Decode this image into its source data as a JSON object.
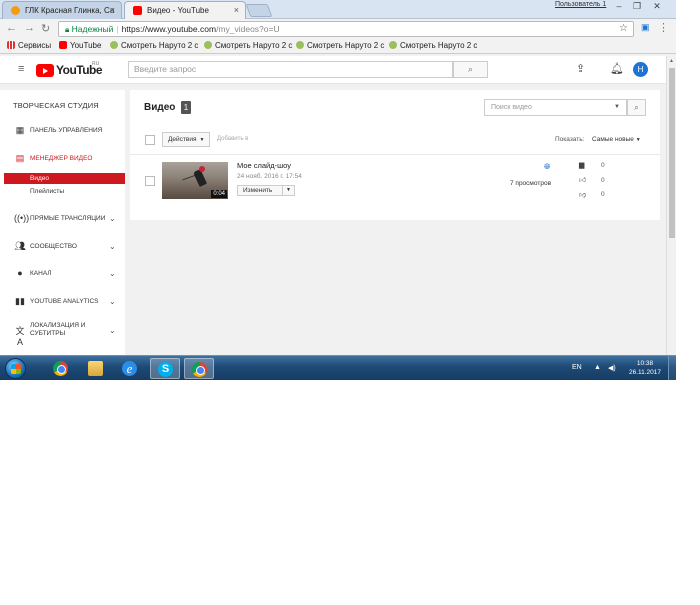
{
  "browser": {
    "tabs": [
      {
        "title": "ГЛК Красная Глинка, Са",
        "icon_color": "#f39c12"
      },
      {
        "title": "Видео - YouTube",
        "icon_color": "#ff0000"
      }
    ],
    "user_label": "Пользователь 1",
    "secure_label": "Надежный",
    "url_main": "https://www.youtube.com",
    "url_path": "/my_videos?o=U",
    "bookmarks": [
      {
        "label": "Сервисы",
        "icon": "apps-icon"
      },
      {
        "label": "YouTube",
        "icon": "youtube-icon"
      },
      {
        "label": "Смотреть Наруто 2 с",
        "icon": "naruto-icon"
      },
      {
        "label": "Смотреть Наруто 2 с",
        "icon": "naruto-icon"
      },
      {
        "label": "Смотреть Наруто 2 с",
        "icon": "naruto-icon"
      },
      {
        "label": "Смотреть Наруто 2 с",
        "icon": "naruto-icon"
      }
    ]
  },
  "header": {
    "logo_text": "YouTube",
    "logo_region": "RU",
    "search_placeholder": "Введите запрос",
    "avatar_letter": "Н"
  },
  "sidebar": {
    "title": "ТВОРЧЕСКАЯ СТУДИЯ",
    "items": [
      {
        "label": "ПАНЕЛЬ УПРАВЛЕНИЯ",
        "icon": "dashboard-icon"
      },
      {
        "label": "МЕНЕДЖЕР ВИДЕО",
        "icon": "video-manager-icon"
      },
      {
        "label": "ПРЯМЫЕ ТРАНСЛЯЦИИ",
        "icon": "live-icon"
      },
      {
        "label": "СООБЩЕСТВО",
        "icon": "community-icon"
      },
      {
        "label": "КАНАЛ",
        "icon": "channel-icon"
      },
      {
        "label": "YOUTUBE ANALYTICS",
        "icon": "analytics-icon"
      },
      {
        "label": "ЛОКАЛИЗАЦИЯ И",
        "label2": "СУБТИТРЫ",
        "icon": "translate-icon"
      }
    ],
    "subitems": [
      "Видео",
      "Плейлисты"
    ]
  },
  "main": {
    "title": "Видео",
    "count": "1",
    "search_placeholder": "Поиск видео",
    "actions_label": "Действия",
    "add_label": "Добавить в",
    "show_label": "Показать:",
    "sort_value": "Самые новые",
    "video": {
      "title": "Мое слайд-шоу",
      "date": "24 нояб. 2016 г. 17:54",
      "duration": "0:04",
      "edit_label": "Изменить",
      "views": "7 просмотров",
      "comments": "0",
      "likes": "0",
      "dislikes": "0"
    }
  },
  "taskbar": {
    "lang": "EN",
    "time": "10:38",
    "date": "26.11.2017"
  }
}
